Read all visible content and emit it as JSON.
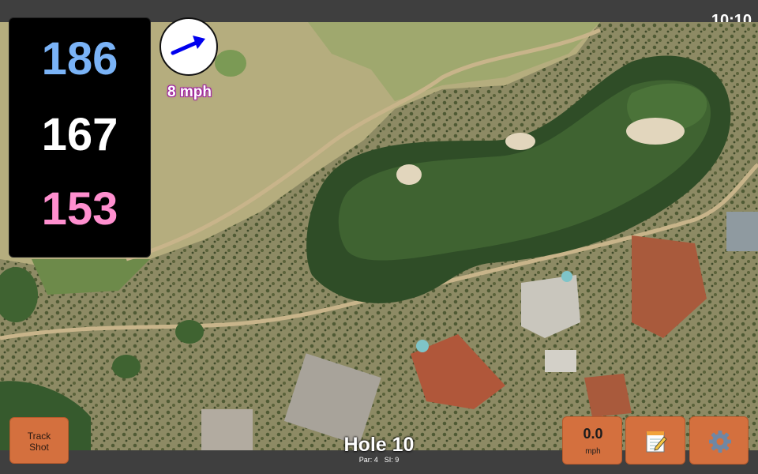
{
  "status_bar": {
    "time": "10:10"
  },
  "yardages": {
    "back": "186",
    "middle": "167",
    "front": "153"
  },
  "wind": {
    "speed_label": "8 mph",
    "direction_icon": "wind-arrow-icon",
    "arrow_color": "#0000ee"
  },
  "toolbar": {
    "track_shot_line1": "Track",
    "track_shot_line2": "Shot",
    "speed_value": "0.0",
    "speed_unit": "mph",
    "notes_icon": "notepad-icon",
    "settings_icon": "gear-icon",
    "button_color": "#d4703e"
  },
  "hole": {
    "title": "Hole 10",
    "par": "Par: 4",
    "stroke_index": "SI: 9"
  },
  "colors": {
    "back_yardage": "#7ab3f7",
    "middle_yardage": "#ffffff",
    "front_yardage": "#ff8fcf"
  }
}
